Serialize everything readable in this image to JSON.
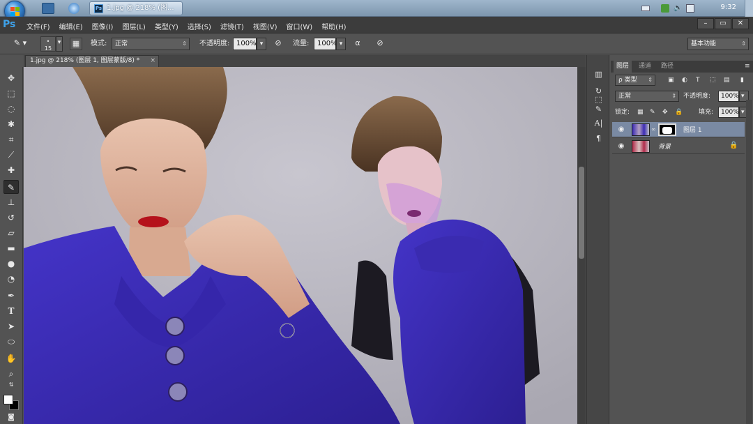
{
  "taskbar": {
    "task_label": "1.jpg @ 218% (图...",
    "clock": "9:32"
  },
  "app": {
    "logo": "Ps",
    "menus": [
      "文件(F)",
      "编辑(E)",
      "图像(I)",
      "图层(L)",
      "类型(Y)",
      "选择(S)",
      "滤镜(T)",
      "视图(V)",
      "窗口(W)",
      "帮助(H)"
    ]
  },
  "options": {
    "brush_size": "15",
    "mode_label": "模式:",
    "mode_value": "正常",
    "opacity_label": "不透明度:",
    "opacity_value": "100%",
    "flow_label": "流量:",
    "flow_value": "100%",
    "workspace": "基本功能"
  },
  "document": {
    "tab_title": "1.jpg @ 218% (图层 1, 图层蒙版/8) *",
    "close": "×"
  },
  "layers_panel": {
    "tabs": [
      "图层",
      "通道",
      "路径"
    ],
    "filter_type": "ρ 类型",
    "blend_mode": "正常",
    "opacity_label": "不透明度:",
    "opacity_value": "100%",
    "lock_label": "锁定:",
    "fill_label": "填充:",
    "fill_value": "100%",
    "layers": [
      {
        "name": "图层 1",
        "active": true
      },
      {
        "name": "背景",
        "active": false,
        "locked": true
      }
    ]
  },
  "colors": {
    "foreground": "#ffffff",
    "background": "#000000",
    "garment_blue": "#3b2bb5"
  }
}
